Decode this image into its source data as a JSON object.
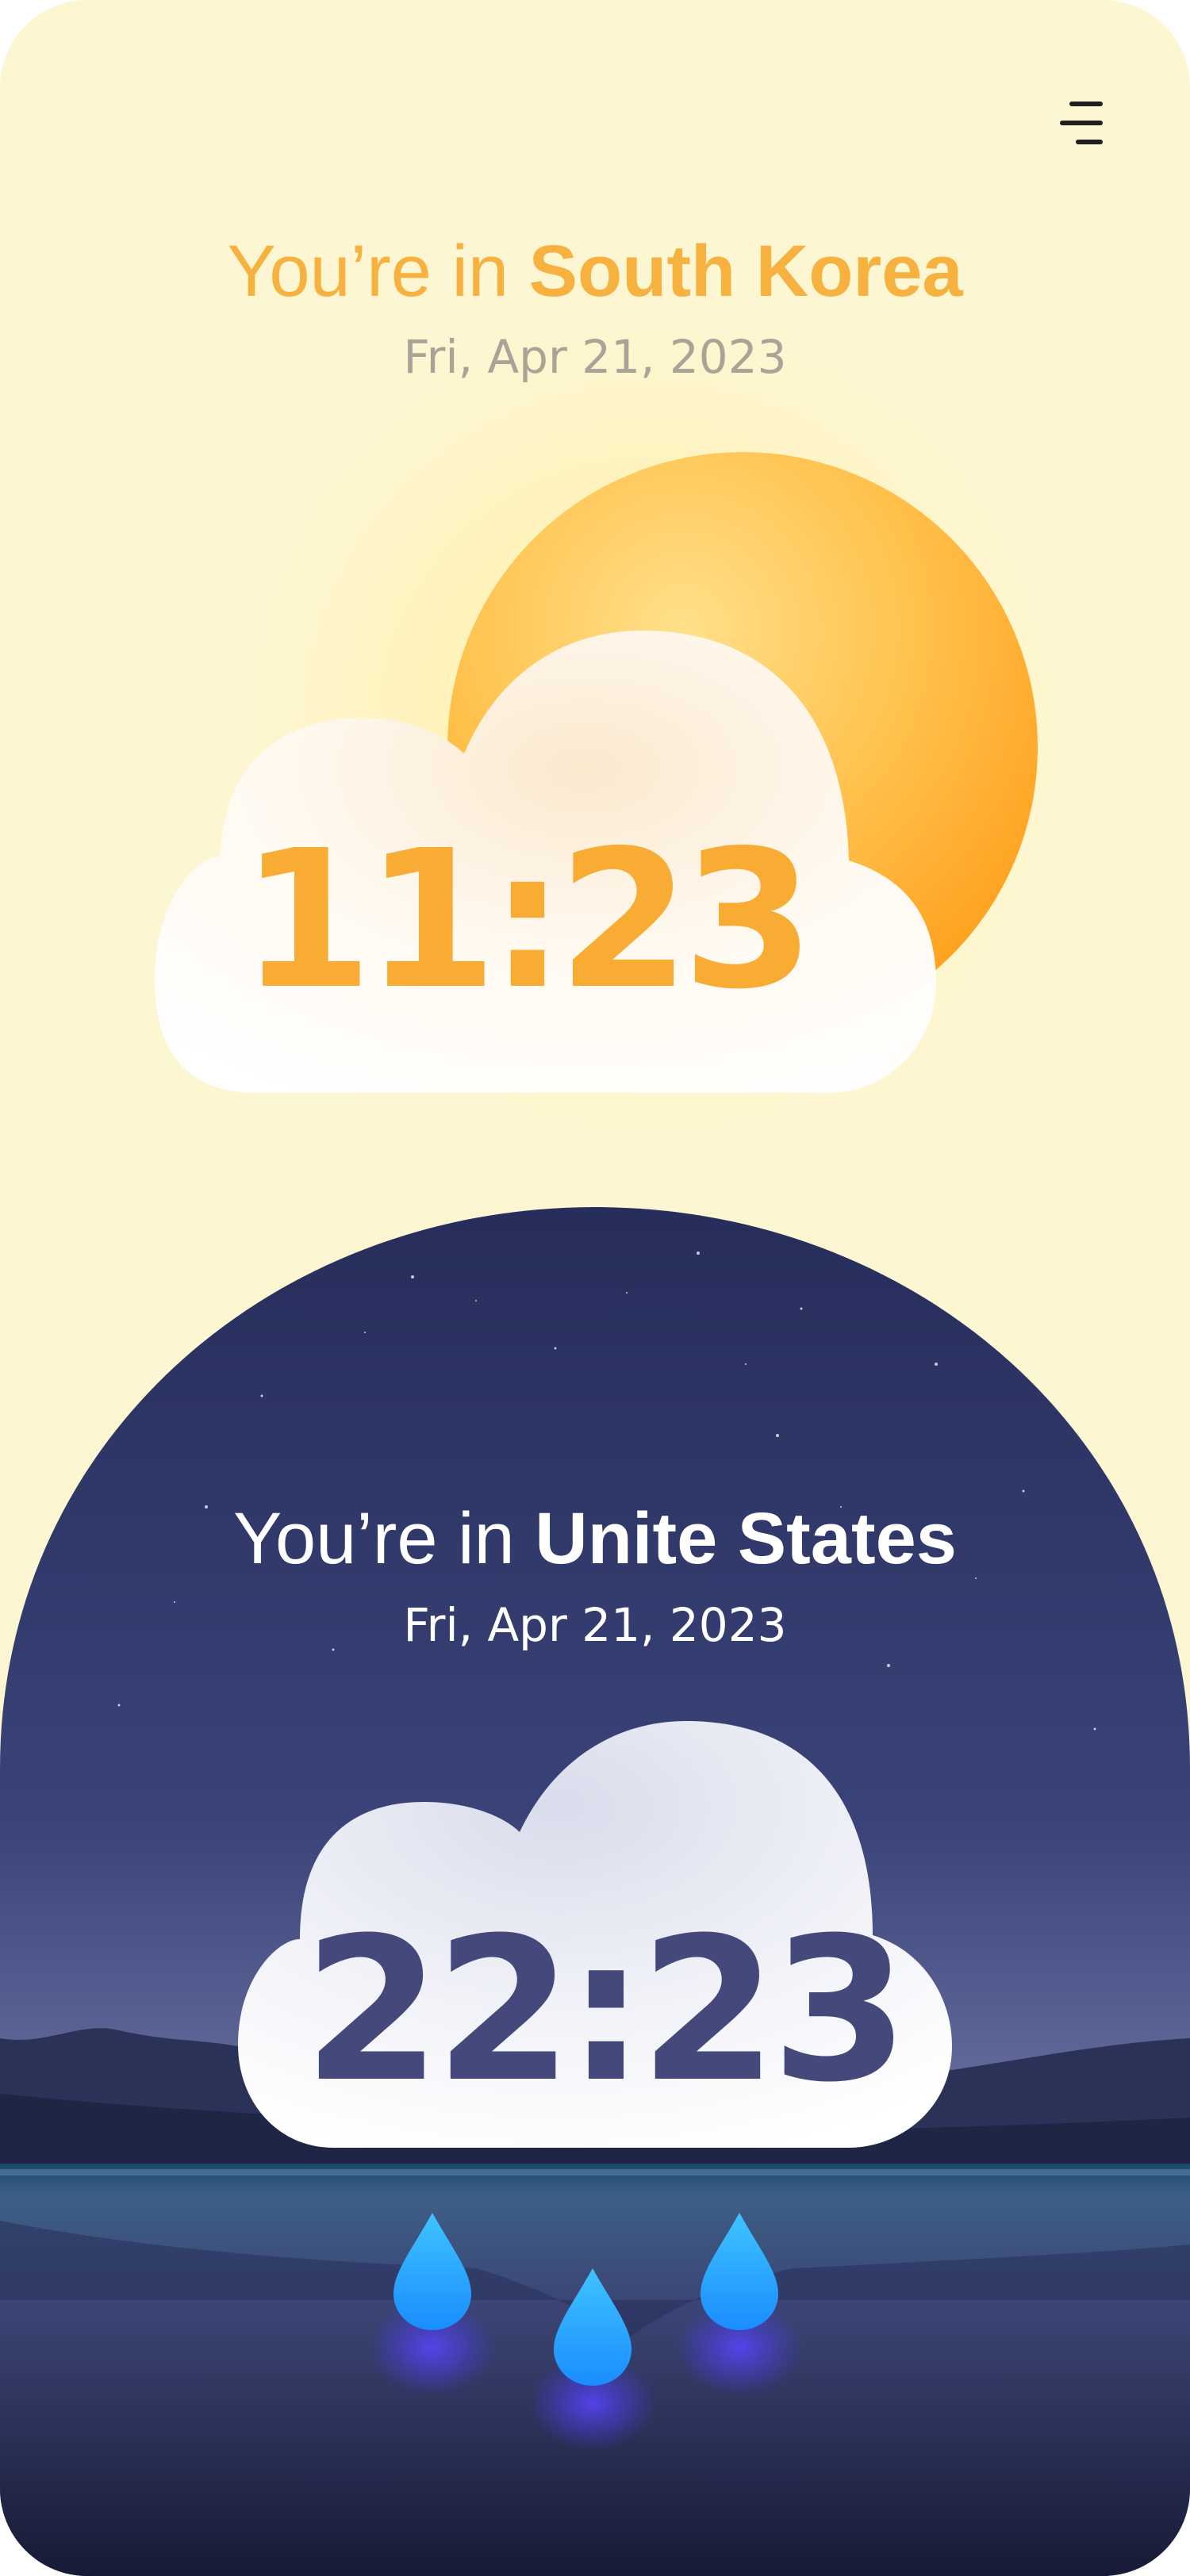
{
  "menu": {
    "icon": "menu-icon"
  },
  "primary": {
    "location_prefix": "You’re in ",
    "location_name": "South Korea",
    "date": "Fri, Apr 21, 2023",
    "time": "11:23",
    "weather_icon": "partly-sunny-icon",
    "accent_color": "#f8ac33"
  },
  "secondary": {
    "location_prefix": "You’re in ",
    "location_name": "Unite States",
    "date": "Fri, Apr 21, 2023",
    "time": "22:23",
    "weather_icon": "rain-cloud-icon",
    "accent_color": "#44487a"
  },
  "colors": {
    "background": "#fdf6d2",
    "sun": "#ffb02e",
    "night_sky": "#2e3566",
    "rain_drop": "#1aa8ff"
  }
}
